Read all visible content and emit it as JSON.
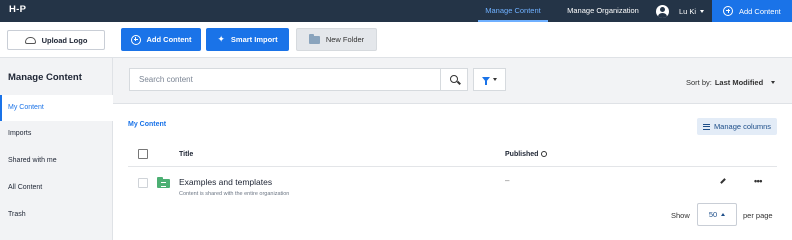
{
  "topbar": {
    "logo": "H-P",
    "nav": [
      "Manage Content",
      "Manage Organization"
    ],
    "user_name": "Lu Ki",
    "add_content": "Add Content"
  },
  "actions": {
    "upload_logo": "Upload Logo",
    "add_content": "Add Content",
    "smart_import": "Smart Import",
    "new_folder": "New Folder"
  },
  "sidebar": {
    "title": "Manage Content",
    "items": [
      "My Content",
      "Imports",
      "Shared with me",
      "All Content",
      "Trash"
    ]
  },
  "search": {
    "placeholder": "Search content",
    "sort_label": "Sort by:",
    "sort_value": "Last Modified"
  },
  "main": {
    "breadcrumb": "My Content",
    "manage_columns": "Manage columns",
    "columns": [
      "Title",
      "Published"
    ],
    "rows": [
      {
        "title": "Examples and templates",
        "subtitle": "Content is shared with the entire organization",
        "published": "–"
      }
    ],
    "pagination": {
      "show": "Show",
      "per_page_value": "50",
      "per_page": "per page"
    }
  },
  "colors": {
    "topbar": "#243447",
    "accent": "#1a73e8",
    "folder_green": "#4caf73"
  }
}
